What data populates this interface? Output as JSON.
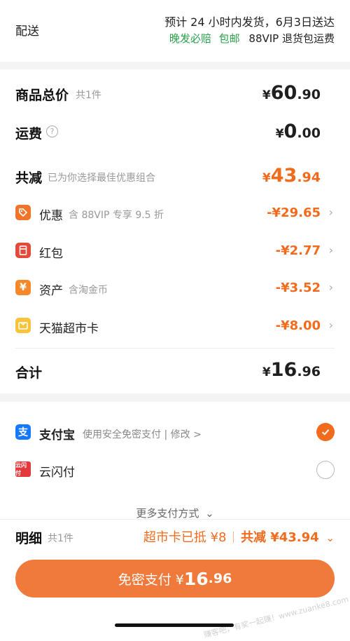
{
  "delivery": {
    "label": "配送",
    "estimate": "预计 24 小时内发货，6月3日送达",
    "late_compensation": "晚发必赔",
    "free_shipping": "包邮",
    "vip_return": "88VIP 退货包运费"
  },
  "summary": {
    "goods_total_label": "商品总价",
    "goods_count": "共1件",
    "goods_total": {
      "cur": "¥",
      "int": "60",
      "dec": ".90"
    },
    "shipping_label": "运费",
    "shipping": {
      "cur": "¥",
      "int": "0",
      "dec": ".00"
    },
    "discount_label": "共减",
    "discount_note": "已为你选择最佳优惠组合",
    "discount_total": {
      "cur": "¥",
      "int": "43",
      "dec": ".94"
    },
    "items": [
      {
        "label": "优惠",
        "note": "含 88VIP 专享 9.5 折",
        "amount": "-¥29.65",
        "icon": "tag-icon",
        "color": "#f0742a"
      },
      {
        "label": "红包",
        "note": "",
        "amount": "-¥2.77",
        "icon": "red-packet-icon",
        "color": "#e24a3b"
      },
      {
        "label": "资产",
        "note": "含淘金币",
        "amount": "-¥3.52",
        "icon": "yen-asset-icon",
        "color": "#f5882a"
      },
      {
        "label": "天猫超市卡",
        "note": "",
        "amount": "-¥8.00",
        "icon": "gift-card-icon",
        "color": "#f6c33a"
      }
    ],
    "total_label": "合计",
    "total": {
      "cur": "¥",
      "int": "16",
      "dec": ".96"
    }
  },
  "payment": {
    "alipay_label": "支付宝",
    "alipay_note": "使用安全免密支付 | 修改 >",
    "unionpay_label": "云闪付",
    "more_label": "更多支付方式",
    "alipay_color": "#1677ff",
    "unionpay_color": "#e4393c"
  },
  "bottom": {
    "detail_label": "明细",
    "detail_count": "共1件",
    "card_deduct": "超市卡已抵 ¥8",
    "total_saved": "共减 ¥43.94",
    "pay_button_prefix": "免密支付 ¥",
    "pay_button_int": "16",
    "pay_button_dec": ".96"
  },
  "watermark": "赚客吧，有奖一起赚！www.zuanke8.com",
  "colors": {
    "accent": "#f26b1d",
    "green": "#2aa24a",
    "button": "#f07a3c"
  }
}
